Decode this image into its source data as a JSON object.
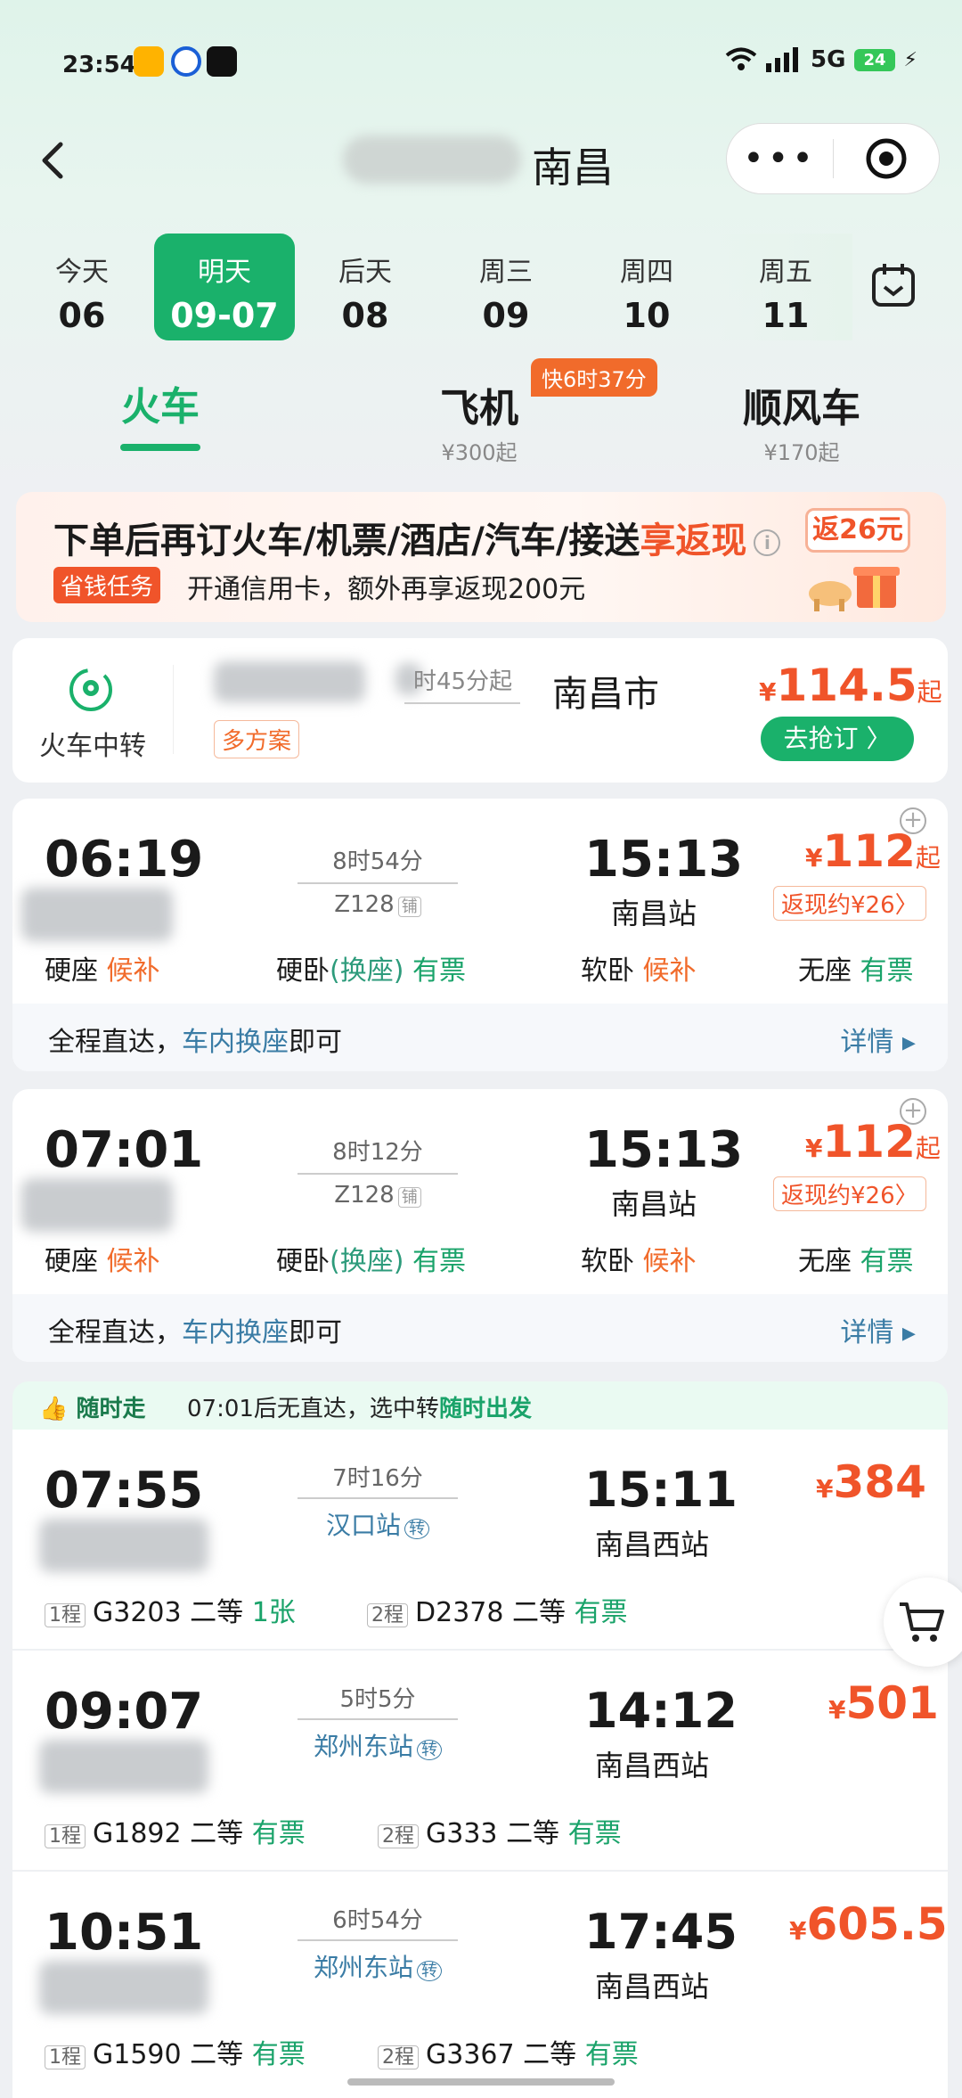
{
  "status": {
    "time": "23:54",
    "network": "5G",
    "battery": "24"
  },
  "nav": {
    "title": "南昌"
  },
  "dates": [
    {
      "week": "今天",
      "day": "06",
      "active": false
    },
    {
      "week": "明天",
      "day": "09-07",
      "active": true
    },
    {
      "week": "后天",
      "day": "08",
      "active": false
    },
    {
      "week": "周三",
      "day": "09",
      "active": false
    },
    {
      "week": "周四",
      "day": "10",
      "active": false
    },
    {
      "week": "周五",
      "day": "11",
      "active": false
    }
  ],
  "modes": [
    {
      "label": "火车",
      "sub": ""
    },
    {
      "label": "飞机",
      "sub": "¥300起"
    },
    {
      "label": "顺风车",
      "sub": "¥170起"
    }
  ],
  "fast_badge": "快6时37分",
  "promo": {
    "line1": "下单后再订火车/机票/酒店/汽车/接送",
    "line1_highlight": "享返现",
    "tag": "省钱任务",
    "line2": "开通信用卡，额外再享返现200元",
    "reward": "返26元"
  },
  "transfer": {
    "label": "火车中转",
    "duration": "时45分起",
    "dest": "南昌市",
    "multi": "多方案",
    "price_symbol": "¥",
    "price": "114.5",
    "price_suffix": "起",
    "button": "去抢订 〉"
  },
  "trains": [
    {
      "dep": "06:19",
      "arr": "15:13",
      "duration": "8时54分",
      "train": "Z128",
      "train_tag": "铺",
      "station": "南昌站",
      "price": "112",
      "price_suffix": "起",
      "cashback": "返现约¥26〉",
      "seats": [
        {
          "name": "硬座",
          "status": "候补"
        },
        {
          "name": "硬卧",
          "extra": "(换座)",
          "status": "有票"
        },
        {
          "name": "软卧",
          "status": "候补"
        },
        {
          "name": "无座",
          "status": "有票"
        }
      ],
      "tip": "全程直达，",
      "tip_link": "车内换座",
      "tip_end": "即可",
      "detail": "详情 ▸"
    },
    {
      "dep": "07:01",
      "arr": "15:13",
      "duration": "8时12分",
      "train": "Z128",
      "train_tag": "铺",
      "station": "南昌站",
      "price": "112",
      "price_suffix": "起",
      "cashback": "返现约¥26〉",
      "seats": [
        {
          "name": "硬座",
          "status": "候补"
        },
        {
          "name": "硬卧",
          "extra": "(换座)",
          "status": "有票"
        },
        {
          "name": "软卧",
          "status": "候补"
        },
        {
          "name": "无座",
          "status": "有票"
        }
      ],
      "tip": "全程直达，",
      "tip_link": "车内换座",
      "tip_end": "即可",
      "detail": "详情 ▸"
    }
  ],
  "anytime": {
    "badge": "随时走",
    "text": "07:01后无直达，选中转",
    "highlight": "随时出发"
  },
  "transfers": [
    {
      "dep": "07:55",
      "arr": "15:11",
      "duration": "7时16分",
      "via": "汉口站",
      "via_tag": "转",
      "station": "南昌西站",
      "price": "384",
      "legs": [
        {
          "n": "1程",
          "train": "G3203",
          "cls": "二等",
          "status": "1张"
        },
        {
          "n": "2程",
          "train": "D2378",
          "cls": "二等",
          "status": "有票"
        }
      ]
    },
    {
      "dep": "09:07",
      "arr": "14:12",
      "duration": "5时5分",
      "via": "郑州东站",
      "via_tag": "转",
      "station": "南昌西站",
      "price": "501",
      "legs": [
        {
          "n": "1程",
          "train": "G1892",
          "cls": "二等",
          "status": "有票"
        },
        {
          "n": "2程",
          "train": "G333",
          "cls": "二等",
          "status": "有票"
        }
      ]
    },
    {
      "dep": "10:51",
      "arr": "17:45",
      "duration": "6时54分",
      "via": "郑州东站",
      "via_tag": "转",
      "station": "南昌西站",
      "price": "605.5",
      "legs": [
        {
          "n": "1程",
          "train": "G1590",
          "cls": "二等",
          "status": "有票"
        },
        {
          "n": "2程",
          "train": "G3367",
          "cls": "二等",
          "status": "有票"
        }
      ]
    }
  ],
  "colors": {
    "accent": "#1ab16b",
    "price": "#f0542a",
    "orange": "#f16b2b",
    "link": "#3a7ca5"
  }
}
